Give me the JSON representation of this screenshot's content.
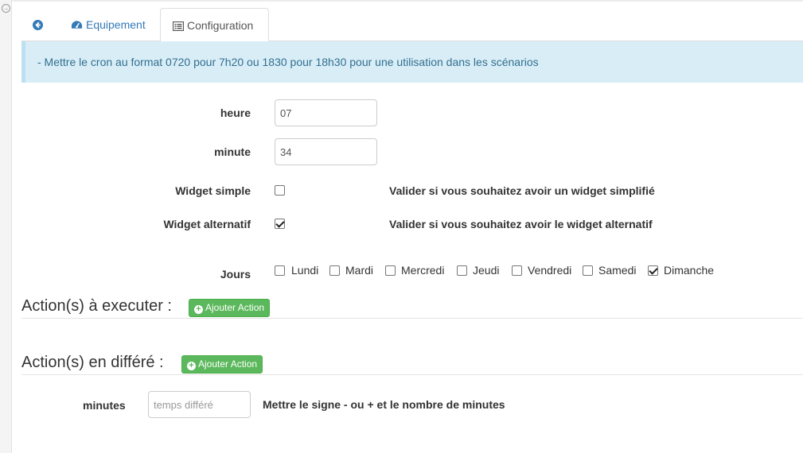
{
  "rail": {
    "toggle_glyph": "→"
  },
  "tabs": {
    "back_icon": "arrow-circle-left-icon",
    "equipement": "Equipement",
    "configuration": "Configuration"
  },
  "alert": {
    "text": "- Mettre le cron au format 0720 pour 7h20 ou 1830 pour 18h30 pour une utilisation dans les scénarios"
  },
  "form": {
    "heure_label": "heure",
    "heure_value": "07",
    "minute_label": "minute",
    "minute_value": "34",
    "widget_simple_label": "Widget simple",
    "widget_simple_checked": false,
    "widget_simple_help": "Valider si vous souhaitez avoir un widget simplifié",
    "widget_alt_label": "Widget alternatif",
    "widget_alt_checked": true,
    "widget_alt_help": "Valider si vous souhaitez avoir le widget alternatif",
    "jours_label": "Jours",
    "days": [
      {
        "label": "Lundi",
        "checked": false
      },
      {
        "label": "Mardi",
        "checked": false
      },
      {
        "label": "Mercredi",
        "checked": false
      },
      {
        "label": "Jeudi",
        "checked": false
      },
      {
        "label": "Vendredi",
        "checked": false
      },
      {
        "label": "Samedi",
        "checked": false
      },
      {
        "label": "Dimanche",
        "checked": true
      }
    ]
  },
  "actions": {
    "title": "Action(s) à executer :",
    "add_label": "Ajouter Action"
  },
  "delayed": {
    "title": "Action(s) en différé :",
    "add_label": "Ajouter Action",
    "minutes_label": "minutes",
    "minutes_placeholder": "temps différé",
    "minutes_help": "Mettre le signe - ou + et le nombre de minutes"
  },
  "colors": {
    "link": "#337ab7",
    "alert_bg": "#d9edf7",
    "alert_text": "#31708f",
    "success": "#5cb85c"
  }
}
